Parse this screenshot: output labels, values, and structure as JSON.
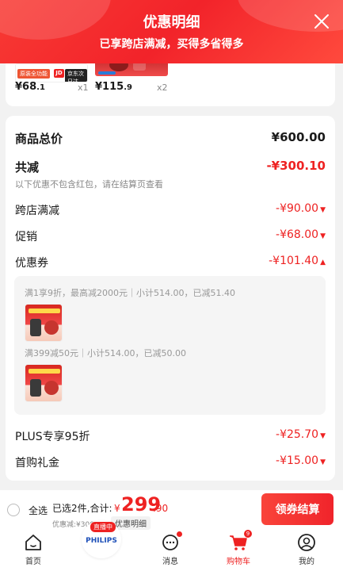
{
  "header": {
    "title": "优惠明细",
    "subtitle": "已享跨店满减，买得多省得多"
  },
  "items": [
    {
      "tag": "原装全功能",
      "tag2": "京东次日达",
      "price_int": "¥68",
      "price_dec": ".1",
      "qty": "x1"
    },
    {
      "price_int": "¥115",
      "price_dec": ".9",
      "qty": "x2"
    }
  ],
  "detail": {
    "total_label": "商品总价",
    "total_value": "¥600.00",
    "discount_label": "共减",
    "discount_value": "-¥300.10",
    "note": "以下优惠不包含红包，请在结算页查看",
    "cross_store_label": "跨店满减",
    "cross_store_value": "-¥90.00",
    "promo_label": "促销",
    "promo_value": "-¥68.00",
    "coupon_label": "优惠券",
    "coupon_value": "-¥101.40",
    "coupons": [
      "满1享9折，最高减2000元｜小计514.00，已减51.40",
      "满399减50元｜小计514.00，已减50.00"
    ],
    "plus_label": "PLUS专享95折",
    "plus_value": "-¥25.70",
    "first_buy_label": "首购礼金",
    "first_buy_value": "-¥15.00"
  },
  "bottom": {
    "select_all": "全选",
    "selected": "已选2件,合计:",
    "currency": "¥",
    "total_int": "299",
    "total_dec": ".90",
    "saved": "优惠减:¥300.10",
    "detail_link": "优惠明细",
    "checkout": "领券结算"
  },
  "tabs": [
    {
      "label": "首页",
      "icon": "home-icon"
    },
    {
      "label": "直播中",
      "brand": "PHILIPS",
      "icon": "live-icon"
    },
    {
      "label": "消息",
      "icon": "message-icon"
    },
    {
      "label": "购物车",
      "icon": "cart-icon",
      "badge": "9"
    },
    {
      "label": "我的",
      "icon": "profile-icon"
    }
  ],
  "colors": {
    "accent": "#f2232a",
    "price": "#e22222"
  }
}
